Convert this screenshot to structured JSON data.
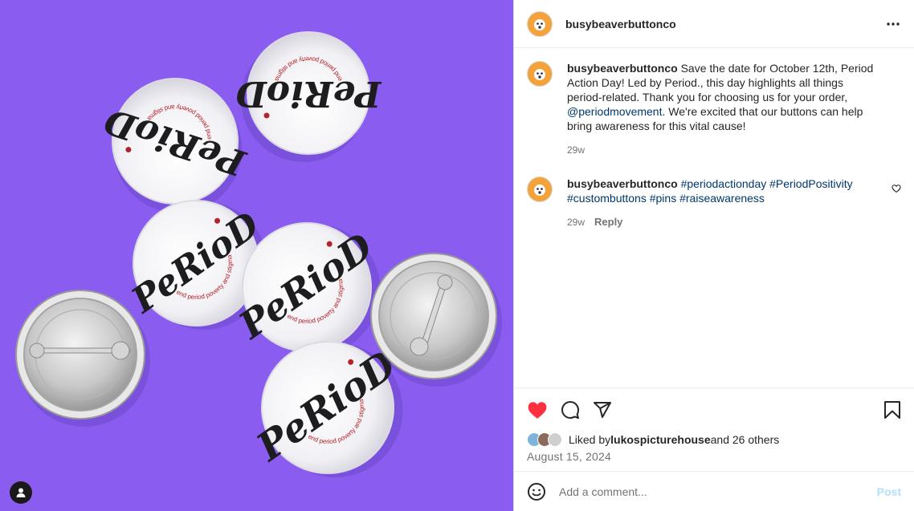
{
  "header": {
    "username": "busybeaverbuttonco"
  },
  "caption": {
    "username": "busybeaverbuttonco",
    "text_before": " Save the date for October 12th, Period Action Day! Led by Period., this day highlights all things period-related. Thank you for choosing us for your order, ",
    "mention": "@periodmovement",
    "text_after": ". We're excited that our buttons can help bring awareness for this vital cause!",
    "time": "29w"
  },
  "comment": {
    "username": "busybeaverbuttonco",
    "tags": [
      "#periodactionday",
      "#PeriodPositivity",
      "#custombuttons",
      "#pins",
      "#raiseawareness"
    ],
    "time": "29w",
    "reply_label": "Reply"
  },
  "likes": {
    "prefix": "Liked by ",
    "user": "lukospicturehouse",
    "suffix": " and 26 others"
  },
  "date": "August 15, 2024",
  "add_comment": {
    "placeholder": "Add a comment...",
    "post_label": "Post"
  },
  "photo": {
    "button_word": "PeRioD",
    "button_tagline": "end period poverty and stigma"
  },
  "colors": {
    "background_purple": "#8b5cf0",
    "like_red": "#ff3040",
    "link_blue": "#00376b",
    "post_disabled": "#b2dffc",
    "avatar_orange": "#f4a23a"
  },
  "icons": [
    "more-icon",
    "heart-filled-icon",
    "comment-icon",
    "share-icon",
    "bookmark-icon",
    "heart-outline-icon",
    "emoji-icon",
    "user-tag-icon"
  ]
}
